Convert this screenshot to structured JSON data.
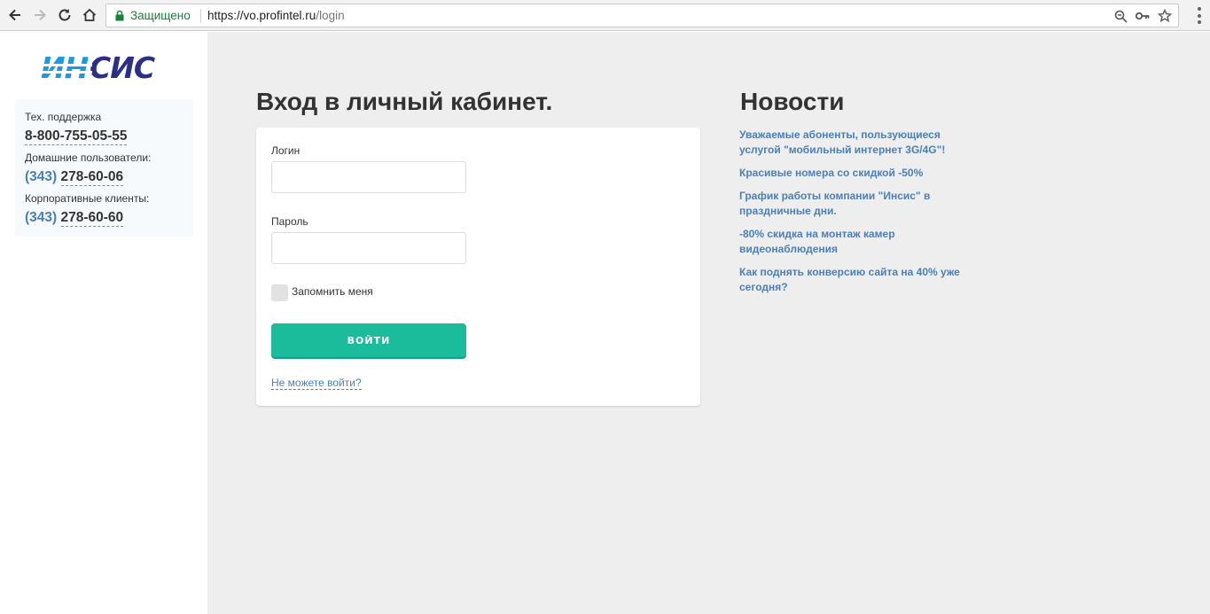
{
  "browser": {
    "secure_label": "Защищено",
    "url_host": "https://vo.profintel.ru",
    "url_path": "/login"
  },
  "brand": {
    "logo_part1": "ИН",
    "logo_part2": "СИС",
    "colors": {
      "blue": "#1a9be0",
      "navy": "#2c2f86",
      "accent": "#1bbc9b",
      "link": "#4a7fb5"
    }
  },
  "contacts": {
    "support_label": "Тех. поддержка",
    "support_phone": "8-800-755-05-55",
    "home_label": "Домашние пользователи:",
    "home_code": "(343)",
    "home_phone": "278-60-06",
    "corp_label": "Корпоративные клиенты:",
    "corp_code": "(343)",
    "corp_phone": "278-60-60"
  },
  "login": {
    "title": "Вход в личный кабинет.",
    "login_label": "Логин",
    "login_value": "",
    "password_label": "Пароль",
    "password_value": "",
    "remember_label": "Запомнить меня",
    "submit_label": "ВОЙТИ",
    "forgot_label": "Не можете войти?"
  },
  "news": {
    "title": "Новости",
    "items": [
      "Уважаемые абоненты, пользующиеся услугой \"мобильный интернет 3G/4G\"!",
      "Красивые номера со скидкой -50%",
      "График работы компании \"Инсис\" в праздничные дни.",
      "-80% скидка на монтаж камер видеонаблюдения",
      "Как поднять конверсию сайта на 40% уже сегодня?"
    ]
  }
}
